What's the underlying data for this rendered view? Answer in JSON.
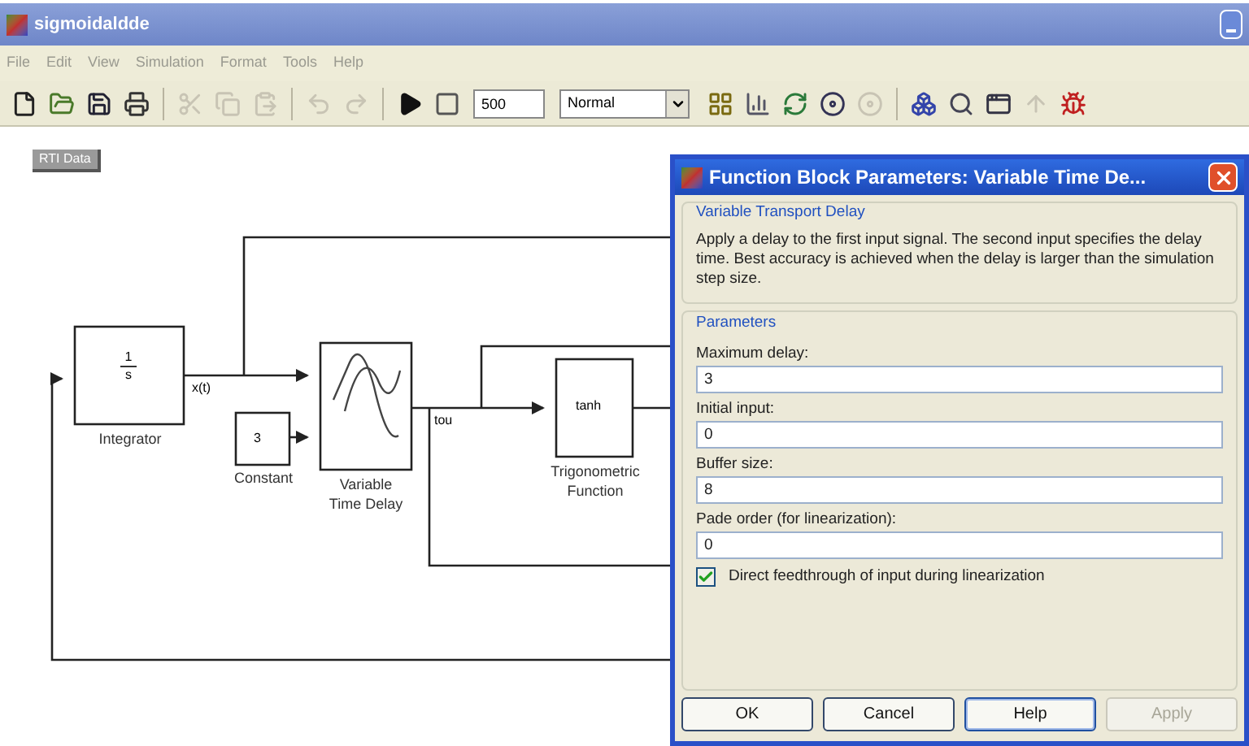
{
  "window": {
    "title": "sigmoidaldde"
  },
  "menu": [
    "File",
    "Edit",
    "View",
    "Simulation",
    "Format",
    "Tools",
    "Help"
  ],
  "toolbar": [
    {
      "kind": "new",
      "disabled": false
    },
    {
      "kind": "open",
      "disabled": false
    },
    {
      "kind": "save",
      "disabled": false
    },
    {
      "kind": "print",
      "disabled": false
    },
    {
      "kind": "sep"
    },
    {
      "kind": "cut",
      "disabled": true
    },
    {
      "kind": "copy",
      "disabled": true
    },
    {
      "kind": "paste",
      "disabled": true
    },
    {
      "kind": "sep"
    },
    {
      "kind": "undo",
      "disabled": true
    },
    {
      "kind": "redo",
      "disabled": true
    },
    {
      "kind": "sep"
    },
    {
      "kind": "play",
      "disabled": false
    },
    {
      "kind": "stop",
      "disabled": false
    }
  ],
  "stop_time": "500",
  "sim_mode": "Normal",
  "toolbar2": [
    {
      "kind": "library",
      "disabled": false
    },
    {
      "kind": "chart",
      "disabled": false
    },
    {
      "kind": "update",
      "disabled": false
    },
    {
      "kind": "disc",
      "disabled": false
    },
    {
      "kind": "blank",
      "disabled": true
    },
    {
      "kind": "sep"
    },
    {
      "kind": "explorer",
      "disabled": false
    },
    {
      "kind": "debug",
      "disabled": false
    },
    {
      "kind": "window",
      "disabled": false
    },
    {
      "kind": "up",
      "disabled": true
    },
    {
      "kind": "bug",
      "disabled": false
    }
  ],
  "annotation": "RTI Data",
  "blocks": [
    {
      "kind": "integrator",
      "num": "1",
      "den": "s",
      "label": [
        "Integrator"
      ]
    },
    {
      "kind": "constant",
      "value": "3",
      "label": [
        "Constant"
      ]
    },
    {
      "kind": "delay",
      "label": [
        "Variable",
        "Time Delay"
      ]
    },
    {
      "kind": "function",
      "value": "tanh",
      "label": [
        "Trigonometric",
        "Function"
      ]
    }
  ],
  "signals": [
    "x(t)",
    "tou"
  ],
  "dialog": {
    "title": "Function Block Parameters: Variable Time De...",
    "block_group": "Variable Transport Delay",
    "description": "Apply a delay to the first input signal.  The second input specifies the delay time.  Best accuracy is achieved when the delay is larger than the simulation step size.",
    "params_group": "Parameters",
    "fields": [
      {
        "label": "Maximum delay:",
        "value": "3"
      },
      {
        "label": "Initial input:",
        "value": "0"
      },
      {
        "label": "Buffer size:",
        "value": "8"
      },
      {
        "label": "Pade order (for linearization):",
        "value": "0"
      }
    ],
    "checkbox": {
      "label": "Direct feedthrough of input during linearization",
      "checked": true
    },
    "buttons": [
      {
        "label": "OK",
        "disabled": false,
        "focused": false
      },
      {
        "label": "Cancel",
        "disabled": false,
        "focused": false
      },
      {
        "label": "Help",
        "disabled": false,
        "focused": true
      },
      {
        "label": "Apply",
        "disabled": true,
        "focused": false
      }
    ]
  }
}
